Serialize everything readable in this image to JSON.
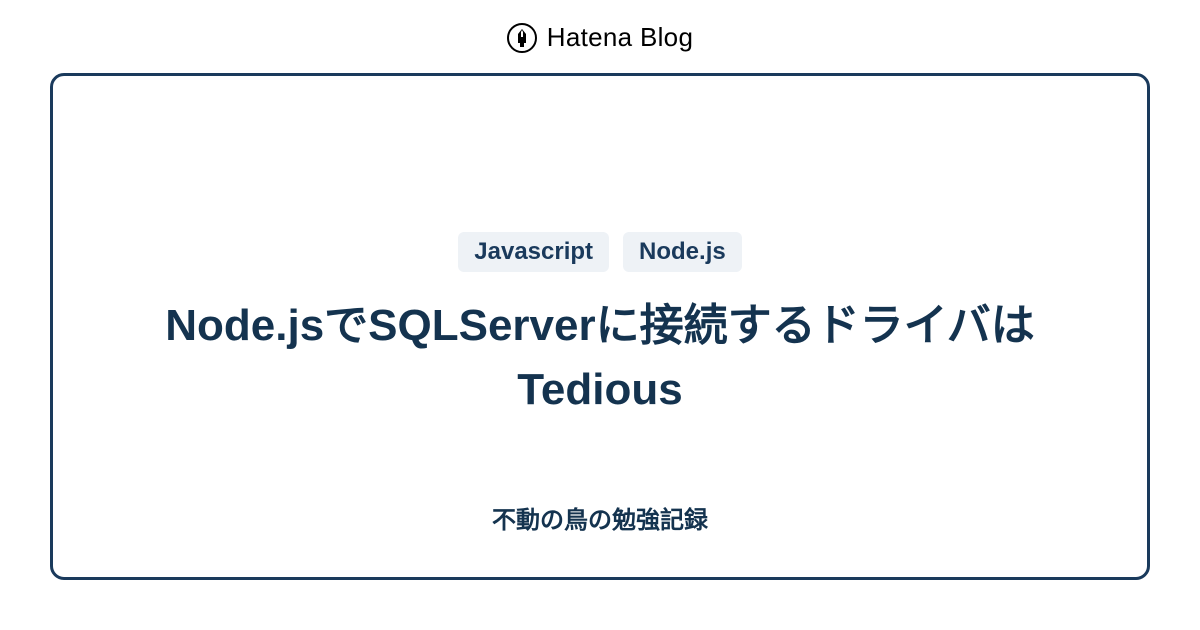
{
  "header": {
    "brand": "Hatena Blog"
  },
  "card": {
    "tags": [
      "Javascript",
      "Node.js"
    ],
    "title": "Node.jsでSQLServerに接続するドライバはTedious",
    "blog_name": "不動の鳥の勉強記録"
  }
}
